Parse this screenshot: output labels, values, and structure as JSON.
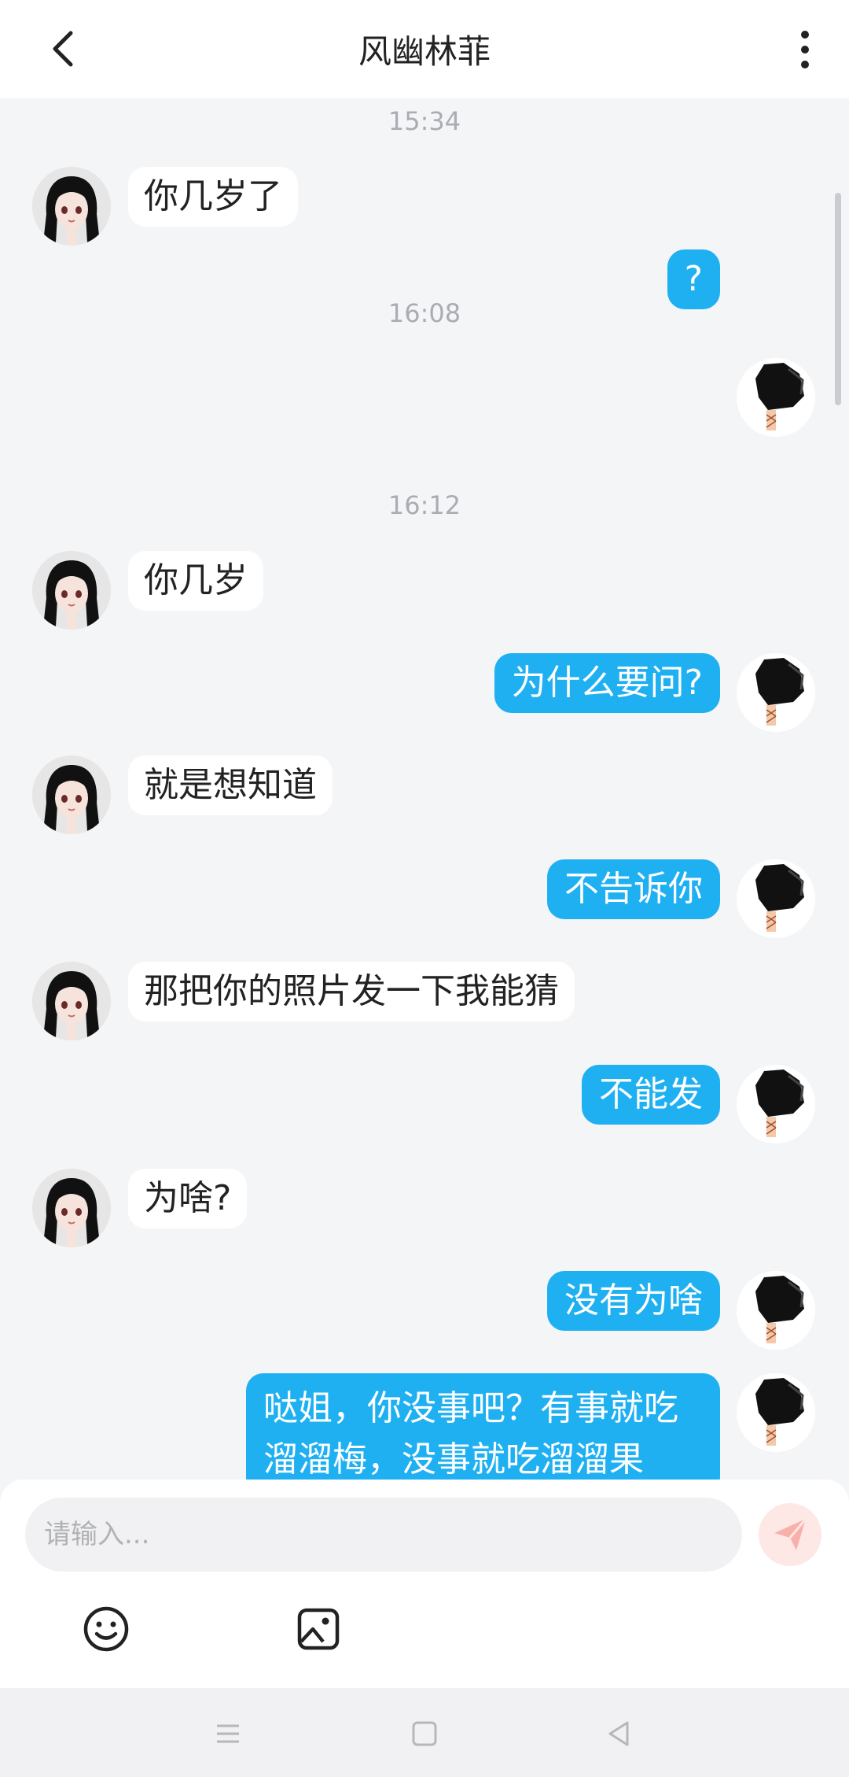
{
  "header": {
    "title": "风幽林菲",
    "back_icon": "chevron-left-icon",
    "more_icon": "vertical-dots-icon"
  },
  "messages": {
    "t1": "15:34",
    "m1": "你几岁了",
    "t2": "16:08",
    "m2": "?",
    "t3": "16:12",
    "m3": "你几岁",
    "m4": "为什么要问?",
    "m5": "就是想知道",
    "m6": "不告诉你",
    "m7": "那把你的照片发一下我能猜",
    "m8": "不能发",
    "m9": "为啥?",
    "m10": "没有为啥",
    "m11": "哒姐，你没事吧？有事就吃溜溜梅，没事就吃溜溜果"
  },
  "composer": {
    "placeholder": "请输入...",
    "send_icon": "send-icon",
    "emoji_icon": "emoji-icon",
    "image_icon": "image-icon"
  },
  "colors": {
    "accent": "#1fb0f2",
    "background": "#f4f5f7",
    "send_disabled": "#fde8e6"
  }
}
